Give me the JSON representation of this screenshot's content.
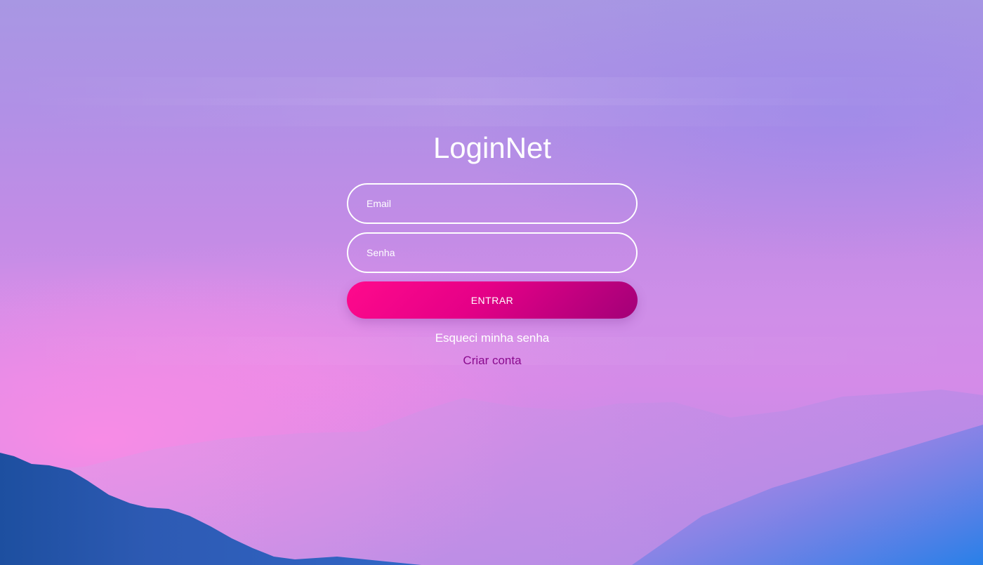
{
  "app": {
    "title": "LoginNet"
  },
  "form": {
    "email_placeholder": "Email",
    "password_placeholder": "Senha",
    "submit_label": "ENTRAR",
    "forgot_link": "Esqueci minha senha",
    "create_link": "Criar conta"
  },
  "colors": {
    "button_gradient_start": "#ff0a8c",
    "button_gradient_end": "#a20078",
    "create_link": "#8a0a8e",
    "text": "#ffffff"
  }
}
